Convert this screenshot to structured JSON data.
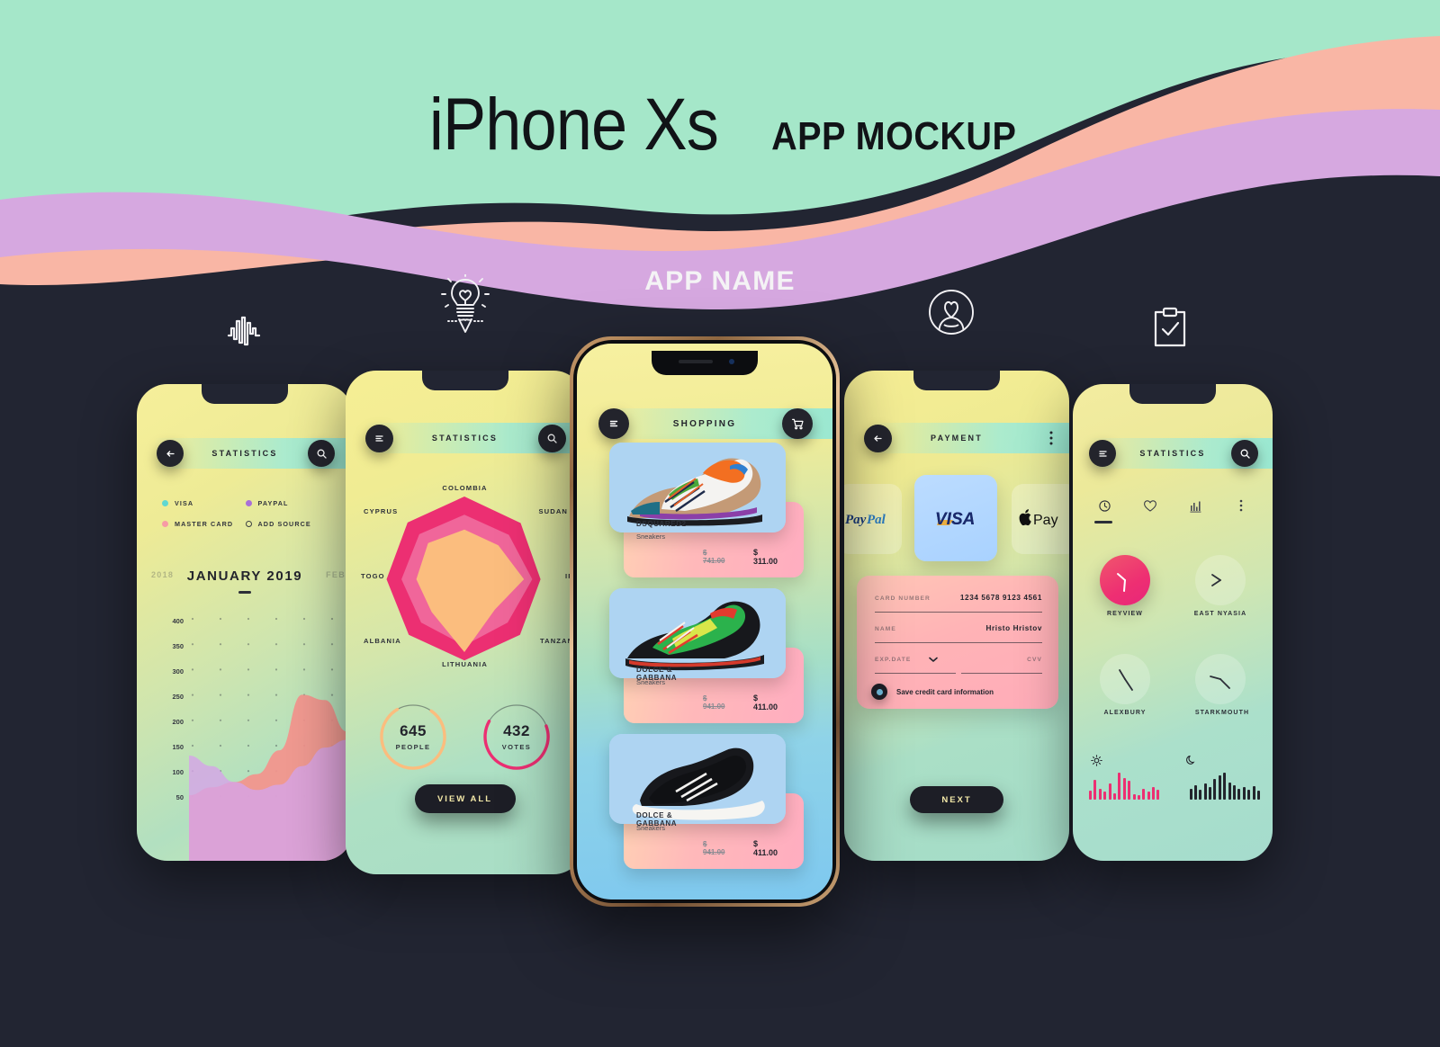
{
  "header": {
    "title_main": "iPhone Xs",
    "title_sub": "APP MOCKUP",
    "app_name": "APP NAME"
  },
  "decor_icons": [
    {
      "name": "waveform-icon",
      "label": "waveform"
    },
    {
      "name": "lightbulb-pencil-icon",
      "label": "idea"
    },
    {
      "name": "user-profile-icon",
      "label": "profile"
    },
    {
      "name": "clipboard-check-icon",
      "label": "checklist"
    }
  ],
  "colors": {
    "background": "#222532",
    "wave_mint": "#a5e7c9",
    "wave_peach": "#f9b6a5",
    "wave_lilac": "#d6a8e0",
    "dark_btn": "#1d1e26",
    "accent_pink": "#ec2f72",
    "accent_orange": "#fbbd7e",
    "accent_cyan": "#5fd8d2",
    "accent_purple": "#a96fd8",
    "btn_text_yellow": "#f4e9a8"
  },
  "phone1": {
    "header_title": "STATISTICS",
    "back_icon": "arrow-left-icon",
    "search_icon": "search-icon",
    "legend": [
      {
        "label": "VISA",
        "color": "#5fd8d2",
        "type": "dot"
      },
      {
        "label": "PAYPAL",
        "color": "#a96fd8",
        "type": "dot"
      },
      {
        "label": "MASTER CARD",
        "color": "#f79ba5",
        "type": "dot"
      },
      {
        "label": "ADD SOURCE",
        "color": "#3c4043",
        "type": "ring"
      }
    ],
    "month_prev": "2018",
    "month_current": "JANUARY 2019",
    "month_next": "FEB",
    "chart_data": {
      "type": "area",
      "title": "JANUARY 2019",
      "xlabel": "",
      "ylabel": "",
      "ylim": [
        0,
        425
      ],
      "yticks": [
        400,
        350,
        300,
        250,
        200,
        150,
        100,
        50
      ],
      "grid": "dotted",
      "x": [
        0,
        1,
        2,
        3,
        4,
        5,
        6,
        7
      ],
      "series": [
        {
          "name": "MASTER CARD",
          "color": "#f4938c",
          "values": [
            95,
            110,
            120,
            135,
            180,
            285,
            275,
            215
          ]
        },
        {
          "name": "PAYPAL",
          "color": "#d6a4e8",
          "values": [
            170,
            150,
            120,
            105,
            115,
            150,
            185,
            200
          ]
        }
      ]
    }
  },
  "phone2": {
    "header_title": "STATISTICS",
    "menu_icon": "menu-icon",
    "search_icon": "search-icon",
    "chart_data": {
      "type": "radar",
      "title": "STATISTICS",
      "categories": [
        "COLOMBIA",
        "SUDAN",
        "IRAN",
        "TANZANIA",
        "LITHUANIA",
        "ALBANIA",
        "TOGO",
        "CYPRUS"
      ],
      "series": [
        {
          "name": "outer",
          "color": "#ec2f72",
          "values": [
            100,
            96,
            92,
            95,
            98,
            95,
            94,
            97
          ]
        },
        {
          "name": "middle",
          "color": "#f0669a",
          "values": [
            78,
            76,
            82,
            74,
            80,
            74,
            76,
            77
          ]
        },
        {
          "name": "inner",
          "color": "#fbbd7e",
          "values": [
            60,
            58,
            72,
            52,
            88,
            56,
            58,
            62
          ]
        }
      ]
    },
    "stats": [
      {
        "value": "645",
        "label": "PEOPLE",
        "ring_color": "#fbbd7e",
        "progress": 0.82
      },
      {
        "value": "432",
        "label": "VOTES",
        "ring_color": "#ec2f72",
        "progress": 0.62
      }
    ],
    "cta": "VIEW ALL"
  },
  "phone3": {
    "header_title": "SHOPPING",
    "menu_icon": "menu-icon",
    "cart_icon": "shopping-cart-icon",
    "products": [
      {
        "brand": "DSQUARED2",
        "category": "Sneakers",
        "old_price": "$ 741.00",
        "new_price": "$ 311.00",
        "img_bg": "#aed4f2"
      },
      {
        "brand": "DOLCE & GABBANA",
        "category": "Sneakers",
        "old_price": "$ 941.00",
        "new_price": "$ 411.00",
        "img_bg": "#aed4f2"
      },
      {
        "brand": "DOLCE & GABBANA",
        "category": "Sneakers",
        "old_price": "$ 941.00",
        "new_price": "$ 411.00",
        "img_bg": "#aed4f2"
      }
    ]
  },
  "phone4": {
    "header_title": "PAYMENT",
    "back_icon": "arrow-left-icon",
    "more_icon": "more-vertical-icon",
    "methods": [
      {
        "name": "PayPal",
        "selected": false
      },
      {
        "name": "VISA",
        "selected": true
      },
      {
        "name": "Apple Pay",
        "selected": false
      }
    ],
    "form": {
      "card_number_label": "CARD NUMBER",
      "card_number_value": "1234 5678 9123 4561",
      "name_label": "NAME",
      "name_value": "Hristo Hristov",
      "exp_label": "EXP.DATE",
      "exp_value": "",
      "cvv_label": "CVV",
      "cvv_value": "",
      "save_label": "Save credit card information",
      "save_checked": true
    },
    "cta": "NEXT"
  },
  "phone5": {
    "header_title": "STATISTICS",
    "menu_icon": "menu-icon",
    "search_icon": "search-icon",
    "tabs": [
      {
        "icon": "clock-icon",
        "active": true
      },
      {
        "icon": "heart-icon",
        "active": false
      },
      {
        "icon": "bar-chart-icon",
        "active": false
      },
      {
        "icon": "more-vertical-icon",
        "active": false
      }
    ],
    "clocks": [
      {
        "name": "REYVIEW",
        "accent": true,
        "hour_deg": 200,
        "minute_deg": 325
      },
      {
        "name": "EAST NYASIA",
        "accent": false,
        "hour_deg": 250,
        "minute_deg": 300
      },
      {
        "name": "ALEXBURY",
        "accent": false,
        "hour_deg": 155,
        "minute_deg": 345
      },
      {
        "name": "STARKMOUTH",
        "accent": false,
        "hour_deg": 130,
        "minute_deg": 265
      }
    ],
    "footer_icons": [
      {
        "name": "sun-icon",
        "bars_color": "#ec2f72"
      },
      {
        "name": "moon-icon",
        "bars_color": "#23252d"
      }
    ],
    "chart_data": [
      {
        "type": "bar",
        "title": "day activity",
        "color": "#ec2f72",
        "values": [
          10,
          22,
          12,
          9,
          18,
          7,
          30,
          24,
          21,
          6,
          5,
          12,
          9,
          14,
          11
        ]
      },
      {
        "type": "bar",
        "title": "night activity",
        "color": "#23252d",
        "values": [
          9,
          12,
          8,
          13,
          10,
          17,
          20,
          22,
          14,
          12,
          9,
          10,
          8,
          11,
          7
        ]
      }
    ]
  }
}
